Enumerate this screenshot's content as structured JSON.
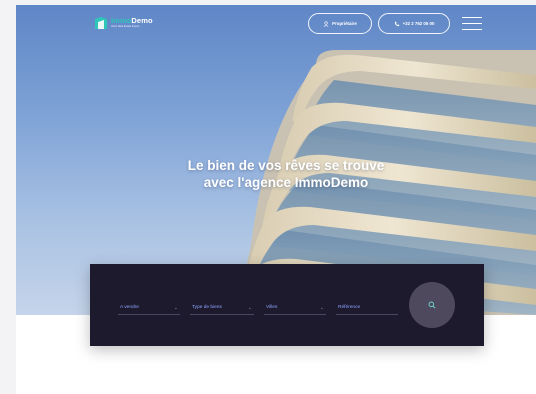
{
  "brand": {
    "name_prefix": "Immo",
    "name_suffix": "Demo",
    "tagline": "Votre Real Estate Expert",
    "accent_color": "#2ec6b9",
    "icon": "house-mark-icon"
  },
  "header": {
    "owner_label": "Propriétaire",
    "owner_icon": "user-icon",
    "phone_label": "+32 2 762 05 00",
    "phone_icon": "phone-icon",
    "menu_icon": "hamburger-icon"
  },
  "hero": {
    "headline_line1": "Le bien de vos rêves se trouve",
    "headline_line2": "avec l'agence ImmoDemo"
  },
  "search": {
    "transaction": "A vendre",
    "property_type": "Type de biens",
    "city": "Villes",
    "reference_placeholder": "Référence",
    "button_icon": "search-icon",
    "panel_color": "#1e1a2e",
    "field_text_color": "#8fa4ff"
  }
}
